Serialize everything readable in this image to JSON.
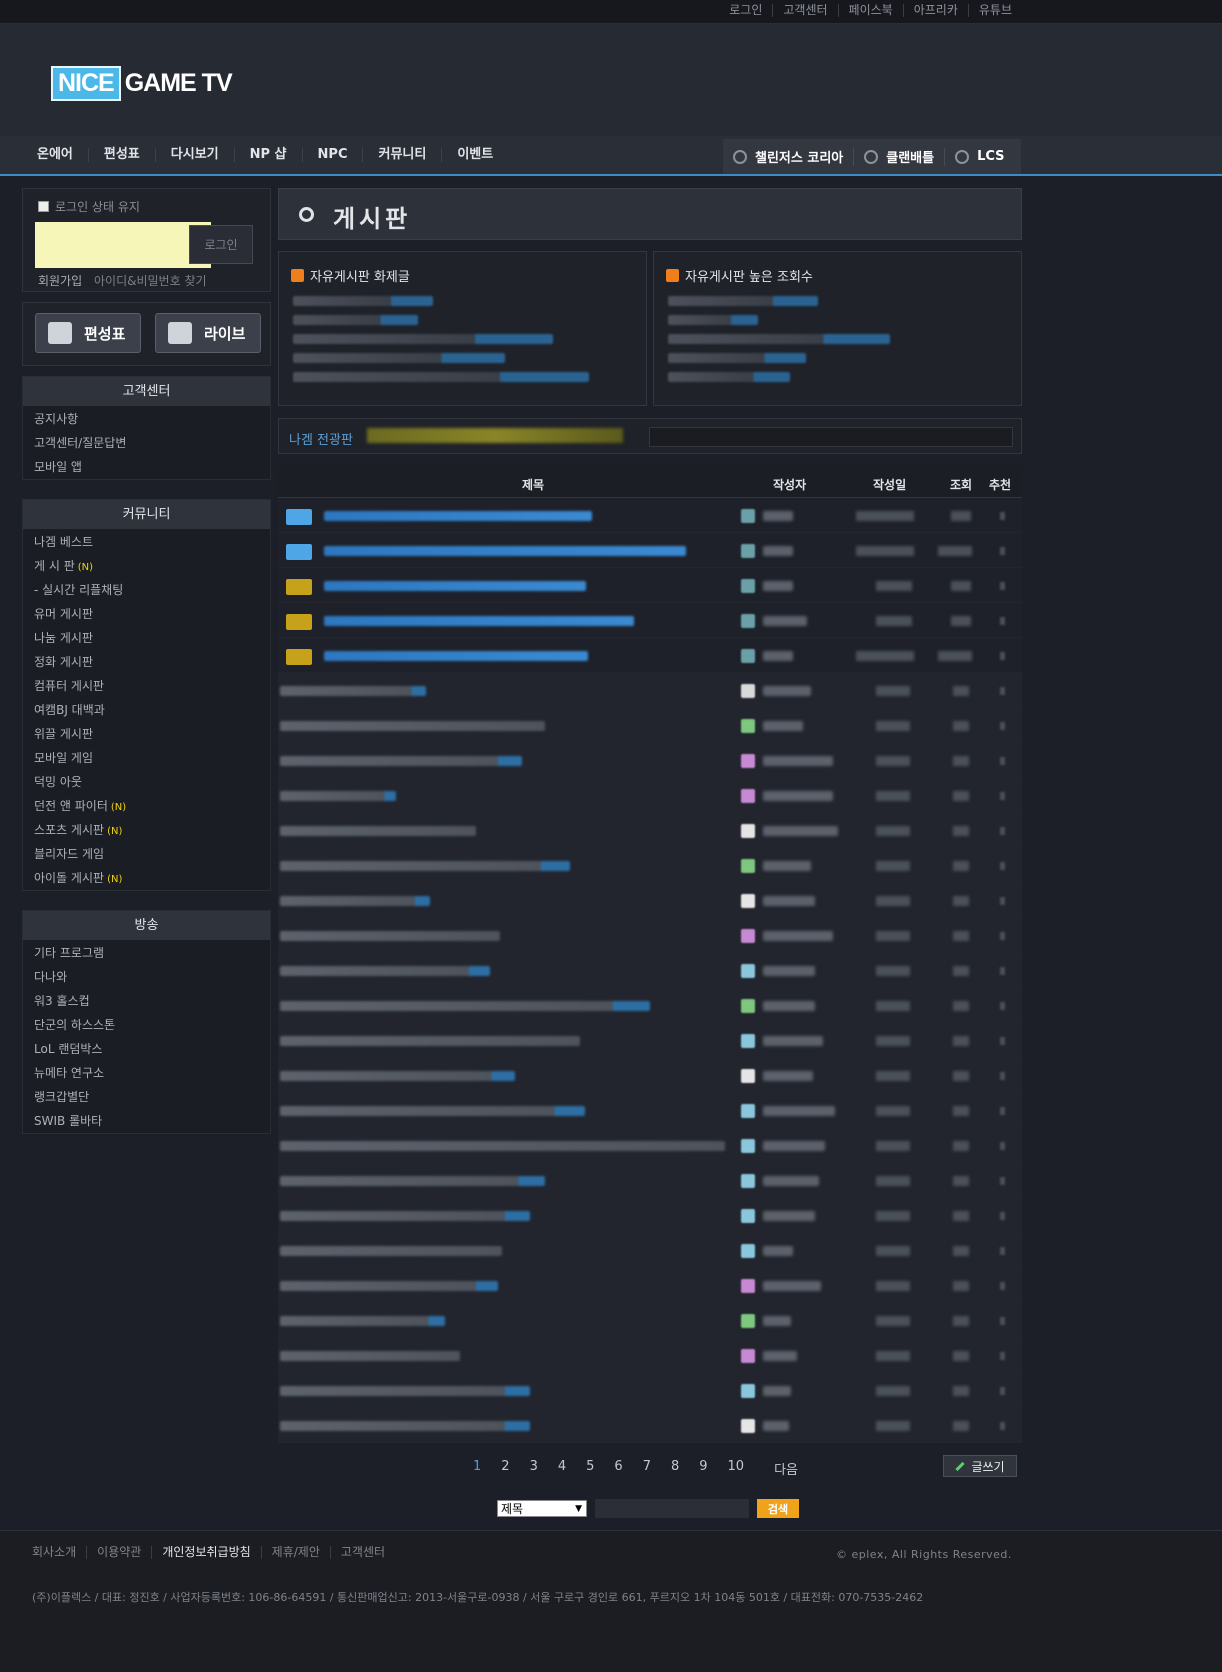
{
  "top_links": [
    "로그인",
    "고객센터",
    "페이스북",
    "아프리카",
    "유튜브"
  ],
  "logo": {
    "part1": "NICE",
    "part2": "GAME TV"
  },
  "nav": {
    "main": [
      "온에어",
      "편성표",
      "다시보기",
      "NP 샵",
      "NPC",
      "커뮤니티",
      "이벤트"
    ],
    "right": [
      "챌린저스 코리아",
      "클랜배틀",
      "LCS"
    ]
  },
  "login": {
    "keep_label": "로그인 상태 유지",
    "button": "로그인",
    "join": "회원가입",
    "find": "아이디&비밀번호 찾기"
  },
  "quick": {
    "schedule": "편성표",
    "live": "라이브"
  },
  "customer": {
    "header": "고객센터",
    "items": [
      "공지사항",
      "고객센터/질문답변",
      "모바일 앱"
    ]
  },
  "community": {
    "header": "커뮤니티",
    "items": [
      {
        "label": "나겜 베스트",
        "new": ""
      },
      {
        "label": "게 시 판",
        "new": "(N)"
      },
      {
        "label": "- 실시간 리플채팅",
        "new": ""
      },
      {
        "label": "유머 게시판",
        "new": ""
      },
      {
        "label": "나눔 게시판",
        "new": ""
      },
      {
        "label": "정화 게시판",
        "new": ""
      },
      {
        "label": "컴퓨터 게시판",
        "new": ""
      },
      {
        "label": "여캠BJ 대백과",
        "new": ""
      },
      {
        "label": "위끌 게시판",
        "new": ""
      },
      {
        "label": "모바일 게임",
        "new": ""
      },
      {
        "label": "덕밍 아웃",
        "new": ""
      },
      {
        "label": "던전 앤 파이터",
        "new": "(N)"
      },
      {
        "label": "스포츠 게시판",
        "new": "(N)"
      },
      {
        "label": "블리자드 게임",
        "new": ""
      },
      {
        "label": "아이돌 게시판",
        "new": "(N)"
      }
    ]
  },
  "broadcast": {
    "header": "방송",
    "items": [
      "기타 프로그램",
      "다나와",
      "워3 홀스컵",
      "단군의 하스스톤",
      "LoL 랜덤박스",
      "뉴메타 연구소",
      "랭크갑별단",
      "SWIB 롤바타"
    ]
  },
  "board": {
    "title": "게시판"
  },
  "hot": {
    "left_title": "자유게시판 화제글",
    "right_title": "자유게시판 높은 조회수"
  },
  "nagem": {
    "label": "나겜 전광판"
  },
  "table": {
    "headers": [
      "제목",
      "작성자",
      "작성일",
      "조회",
      "추천"
    ]
  },
  "pager": {
    "pages": [
      "1",
      "2",
      "3",
      "4",
      "5",
      "6",
      "7",
      "8",
      "9",
      "10"
    ],
    "next": "다음",
    "current": "1"
  },
  "write_button": "글쓰기",
  "search": {
    "select_value": "제목",
    "button": "검색"
  },
  "footer": {
    "links": [
      "회사소개",
      "이용약관",
      "개인정보취급방침",
      "제휴/제안",
      "고객센터"
    ],
    "copyright": "© eplex, All Rights Reserved.",
    "address": "(주)이플렉스 / 대표: 정진호 / 사업자등록번호: 106-86-64591 / 통신판매업신고: 2013-서울구로-0938 / 서울 구로구 경인로 661, 푸르지오 1차 104동 501호 / 대표전화: 070-7535-2462"
  },
  "colors": {
    "accent": "#3c8dc4",
    "new_badge": "#f2d40a",
    "search_button": "#f0a21b",
    "rss": "#f07e1a"
  }
}
